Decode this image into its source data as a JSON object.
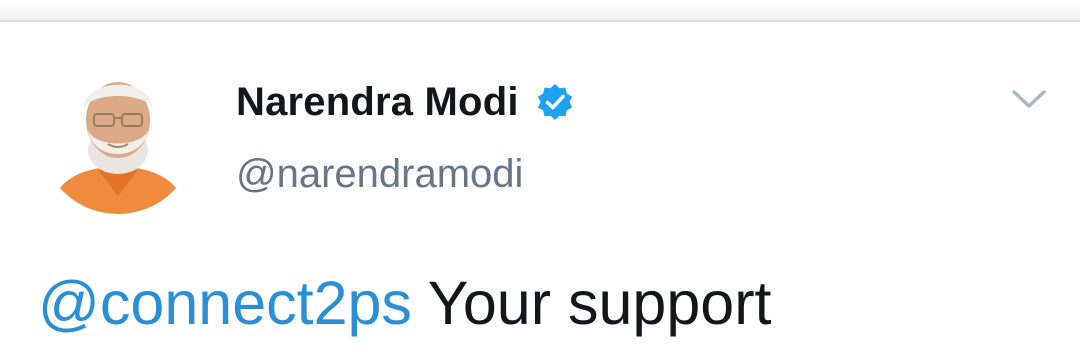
{
  "author": {
    "display_name": "Narendra Modi",
    "handle": "@narendramodi",
    "verified": true,
    "verified_icon": "verified-badge-icon",
    "avatar_icon": "profile-photo"
  },
  "tweet": {
    "mention": "@connect2ps",
    "text_after_mention": "Your support"
  },
  "menu": {
    "icon": "chevron-down-icon"
  },
  "colors": {
    "name_text": "#14171a",
    "handle_text": "#657786",
    "mention_link": "#2a8fd6",
    "verified_badge": "#1da1f2",
    "chevron": "#aab8c2"
  }
}
